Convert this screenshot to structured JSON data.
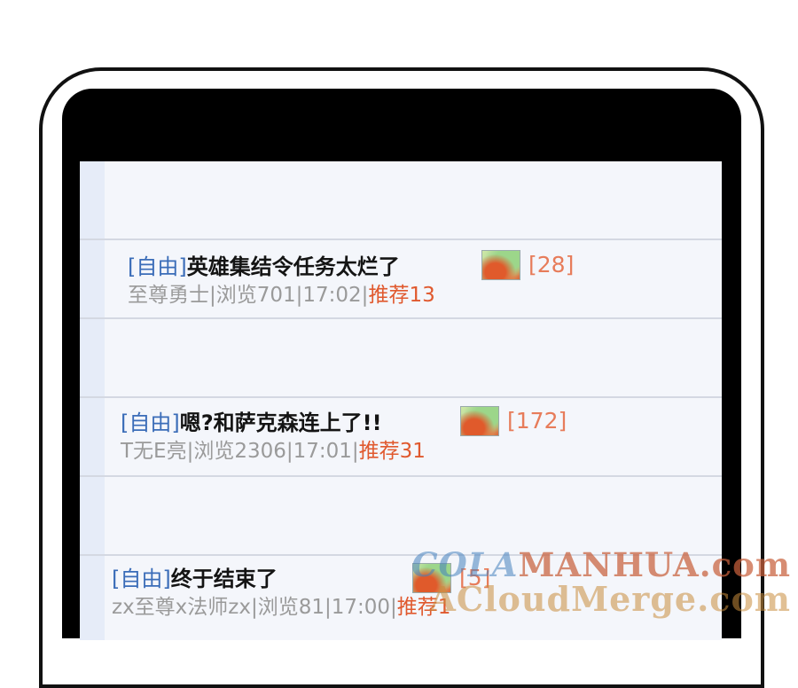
{
  "posts": [
    {
      "tag": "[自由]",
      "title": "英雄集结令任务太烂了",
      "meta_text": "至尊勇士|浏览701|17:02|",
      "recommend_text": "推荐13",
      "reply_count": "[28]"
    },
    {
      "tag": "[自由]",
      "title": "嗯?和萨克森连上了!!",
      "meta_text": "T无E亮|浏览2306|17:01|",
      "recommend_text": "推荐31",
      "reply_count": "[172]"
    },
    {
      "tag": "[自由]",
      "title": "终于结束了",
      "meta_text": "zx至尊x法师zx|浏览81|17:00|",
      "recommend_text": "推荐1",
      "reply_count": "[5]"
    }
  ],
  "watermark": {
    "line1_prefix": "COLA",
    "line1_main": "MANHUA.com",
    "line2": "ACloudMerge.com"
  },
  "colors": {
    "tag": "#3a6cb8",
    "title": "#141414",
    "meta": "#9a9a9a",
    "recommend": "#e0592e",
    "reply_count": "#e77c5a",
    "screen_bg": "#f4f6fb"
  },
  "icons": {
    "thumbnail": "image-thumbnail-icon"
  }
}
